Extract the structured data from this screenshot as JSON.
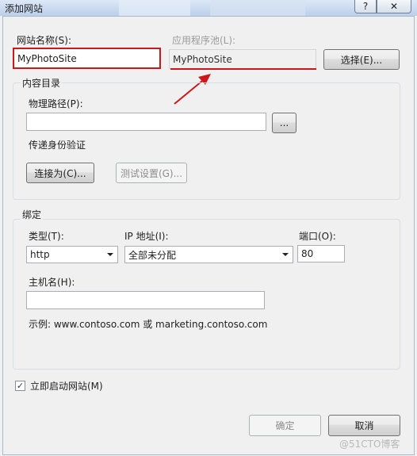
{
  "window": {
    "title": "添加网站",
    "help_glyph": "?",
    "close_glyph": "✕"
  },
  "site_name": {
    "label": "网站名称(S):",
    "value": "MyPhotoSite"
  },
  "app_pool": {
    "label": "应用程序池(L):",
    "value": "MyPhotoSite",
    "select_button": "选择(E)..."
  },
  "content_dir": {
    "legend": "内容目录",
    "physical_path_label": "物理路径(P):",
    "physical_path_value": "",
    "browse_button": "...",
    "pass_through_label": "传递身份验证",
    "connect_as_button": "连接为(C)...",
    "test_settings_button": "测试设置(G)..."
  },
  "binding": {
    "legend": "绑定",
    "type_label": "类型(T):",
    "type_value": "http",
    "ip_label": "IP 地址(I):",
    "ip_value": "全部未分配",
    "port_label": "端口(O):",
    "port_value": "80",
    "hostname_label": "主机名(H):",
    "hostname_value": "",
    "example_text": "示例: www.contoso.com 或 marketing.contoso.com"
  },
  "start_immediately": {
    "label": "立即启动网站(M)",
    "checked": true,
    "check_glyph": "✓"
  },
  "footer": {
    "ok_button": "确定",
    "cancel_button": "取消",
    "watermark": "@51CTO博客"
  },
  "colors": {
    "highlight_red": "#d0151b"
  }
}
